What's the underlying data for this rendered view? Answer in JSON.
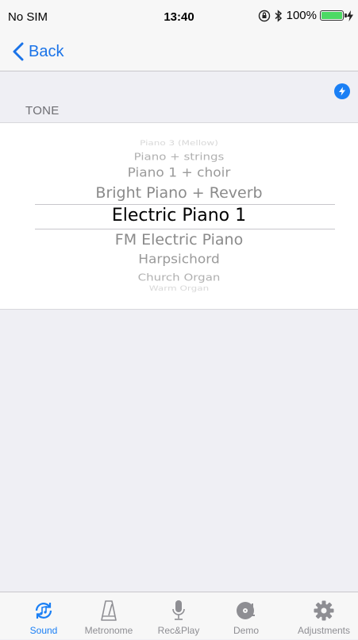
{
  "status_bar": {
    "carrier": "No SIM",
    "time": "13:40",
    "battery_percent": "100%",
    "icons": [
      "orientation-lock-icon",
      "bluetooth-icon",
      "battery-icon",
      "charging-icon"
    ]
  },
  "nav": {
    "back_label": "Back",
    "back_icon": "chevron-left-icon"
  },
  "section": {
    "title": "TONE",
    "badge_icon": "lightning-bolt-icon"
  },
  "picker": {
    "options": [
      "Piano 3 (Mellow)",
      "Piano + strings",
      "Piano 1 + choir",
      "Bright Piano + Reverb",
      "Electric Piano 1",
      "FM Electric Piano",
      "Harpsichord",
      "Church Organ",
      "Warm Organ"
    ],
    "selected": "Electric Piano 1"
  },
  "tab_bar": {
    "active": "Sound",
    "tabs": [
      {
        "label": "Sound",
        "icon": "sound-refresh-icon"
      },
      {
        "label": "Metronome",
        "icon": "metronome-icon"
      },
      {
        "label": "Rec&Play",
        "icon": "microphone-icon"
      },
      {
        "label": "Demo",
        "icon": "vinyl-record-icon"
      },
      {
        "label": "Adjustments",
        "icon": "gear-icon"
      }
    ]
  },
  "colors": {
    "accent": "#1a7ff5",
    "background": "#efeff4",
    "battery": "#4cd964"
  }
}
